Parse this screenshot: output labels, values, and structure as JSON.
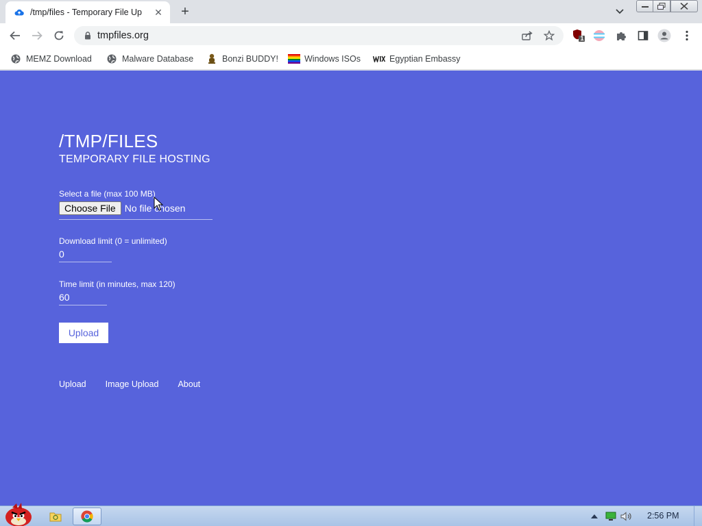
{
  "browser": {
    "tab": {
      "title": "/tmp/files - Temporary File Up"
    },
    "omnibox": {
      "url": "tmpfiles.org"
    },
    "extension_badge": "1",
    "bookmarks": [
      {
        "label": "MEMZ Download",
        "icon": "globe-icon"
      },
      {
        "label": "Malware Database",
        "icon": "globe-icon"
      },
      {
        "label": "Bonzi BUDDY!",
        "icon": "bonzi-icon"
      },
      {
        "label": "Windows ISOs",
        "icon": "rainbow-flag-icon"
      },
      {
        "label": "Egyptian Embassy",
        "icon": "wix-icon"
      }
    ]
  },
  "page": {
    "title": "/TMP/FILES",
    "subtitle": "TEMPORARY FILE HOSTING",
    "file_label": "Select a file (max 100 MB)",
    "choose_file": "Choose File",
    "no_file": "No file chosen",
    "download_limit_label": "Download limit (0 = unlimited)",
    "download_limit_value": "0",
    "time_limit_label": "Time limit (in minutes, max 120)",
    "time_limit_value": "60",
    "upload_button": "Upload",
    "nav": [
      "Upload",
      "Image Upload",
      "About"
    ]
  },
  "colors": {
    "page_background": "#5763dc",
    "button_text": "#5763dc"
  },
  "taskbar": {
    "clock": "2:56 PM"
  }
}
